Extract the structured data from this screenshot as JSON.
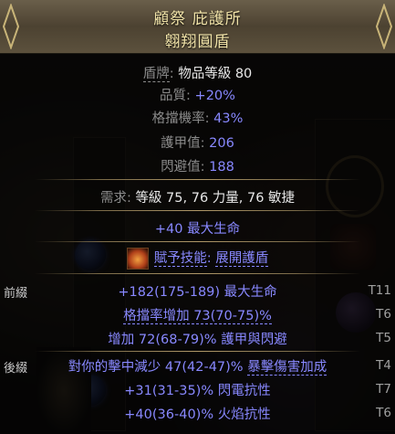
{
  "header": {
    "title_line1": "顧祭 庇護所",
    "title_line2": "翱翔圓盾"
  },
  "properties": {
    "item_class_label": "盾牌",
    "item_class_value": "物品等級 80",
    "quality_label": "品質",
    "quality_value": "+20%",
    "block_label": "格擋機率",
    "block_value": "43%",
    "armour_label": "護甲值",
    "armour_value": "206",
    "evasion_label": "閃避值",
    "evasion_value": "188"
  },
  "requirements": {
    "label": "需求",
    "value": "等級 75, 76 力量, 76 敏捷"
  },
  "implicit": "+40 最大生命",
  "granted_skill": {
    "label": "賦予技能",
    "value": "展開護盾"
  },
  "prefix": {
    "tag": "前綴",
    "mods": [
      {
        "text": "+182(175-189) 最大生命",
        "tier": "T11"
      },
      {
        "text": "格擋率增加 73(70-75)%",
        "tier": "T6"
      },
      {
        "text": "增加 72(68-79)% 護甲與閃避",
        "tier": "T5"
      }
    ]
  },
  "suffix": {
    "tag": "後綴",
    "mods": [
      {
        "text_a": "對你的擊中減少 47(42-47)% ",
        "text_b": "暴擊傷害加成",
        "tier": "T4"
      },
      {
        "text": "+31(31-35)% 閃電抗性",
        "tier": "T7"
      },
      {
        "text": "+40(36-40)% 火焰抗性",
        "tier": "T6"
      }
    ]
  },
  "colors": {
    "title": "#f1e3a8",
    "magic_mod": "#8888ff",
    "label_grey": "#8b8b8b"
  }
}
